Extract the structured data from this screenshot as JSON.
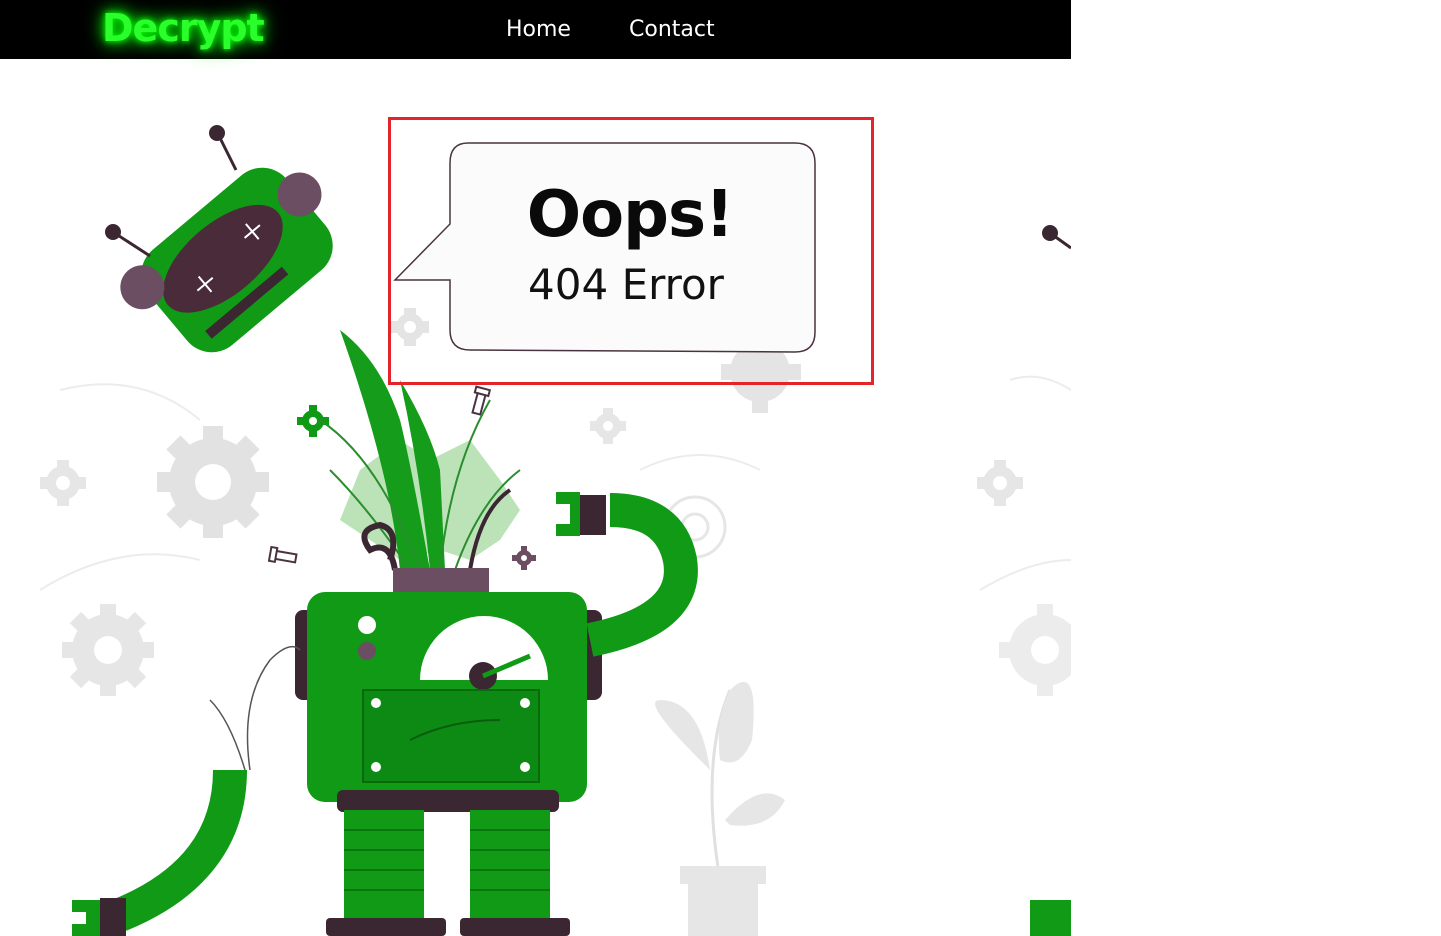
{
  "nav": {
    "brand": "Decrypt",
    "links": [
      "Home",
      "Contact"
    ]
  },
  "error": {
    "heading": "Oops!",
    "message": "404 Error"
  },
  "colors": {
    "nav_bg": "#000000",
    "brand_glow": "#2bff2b",
    "robot_green": "#109a16",
    "robot_dark": "#3b2732",
    "highlight": "#e3242b"
  }
}
